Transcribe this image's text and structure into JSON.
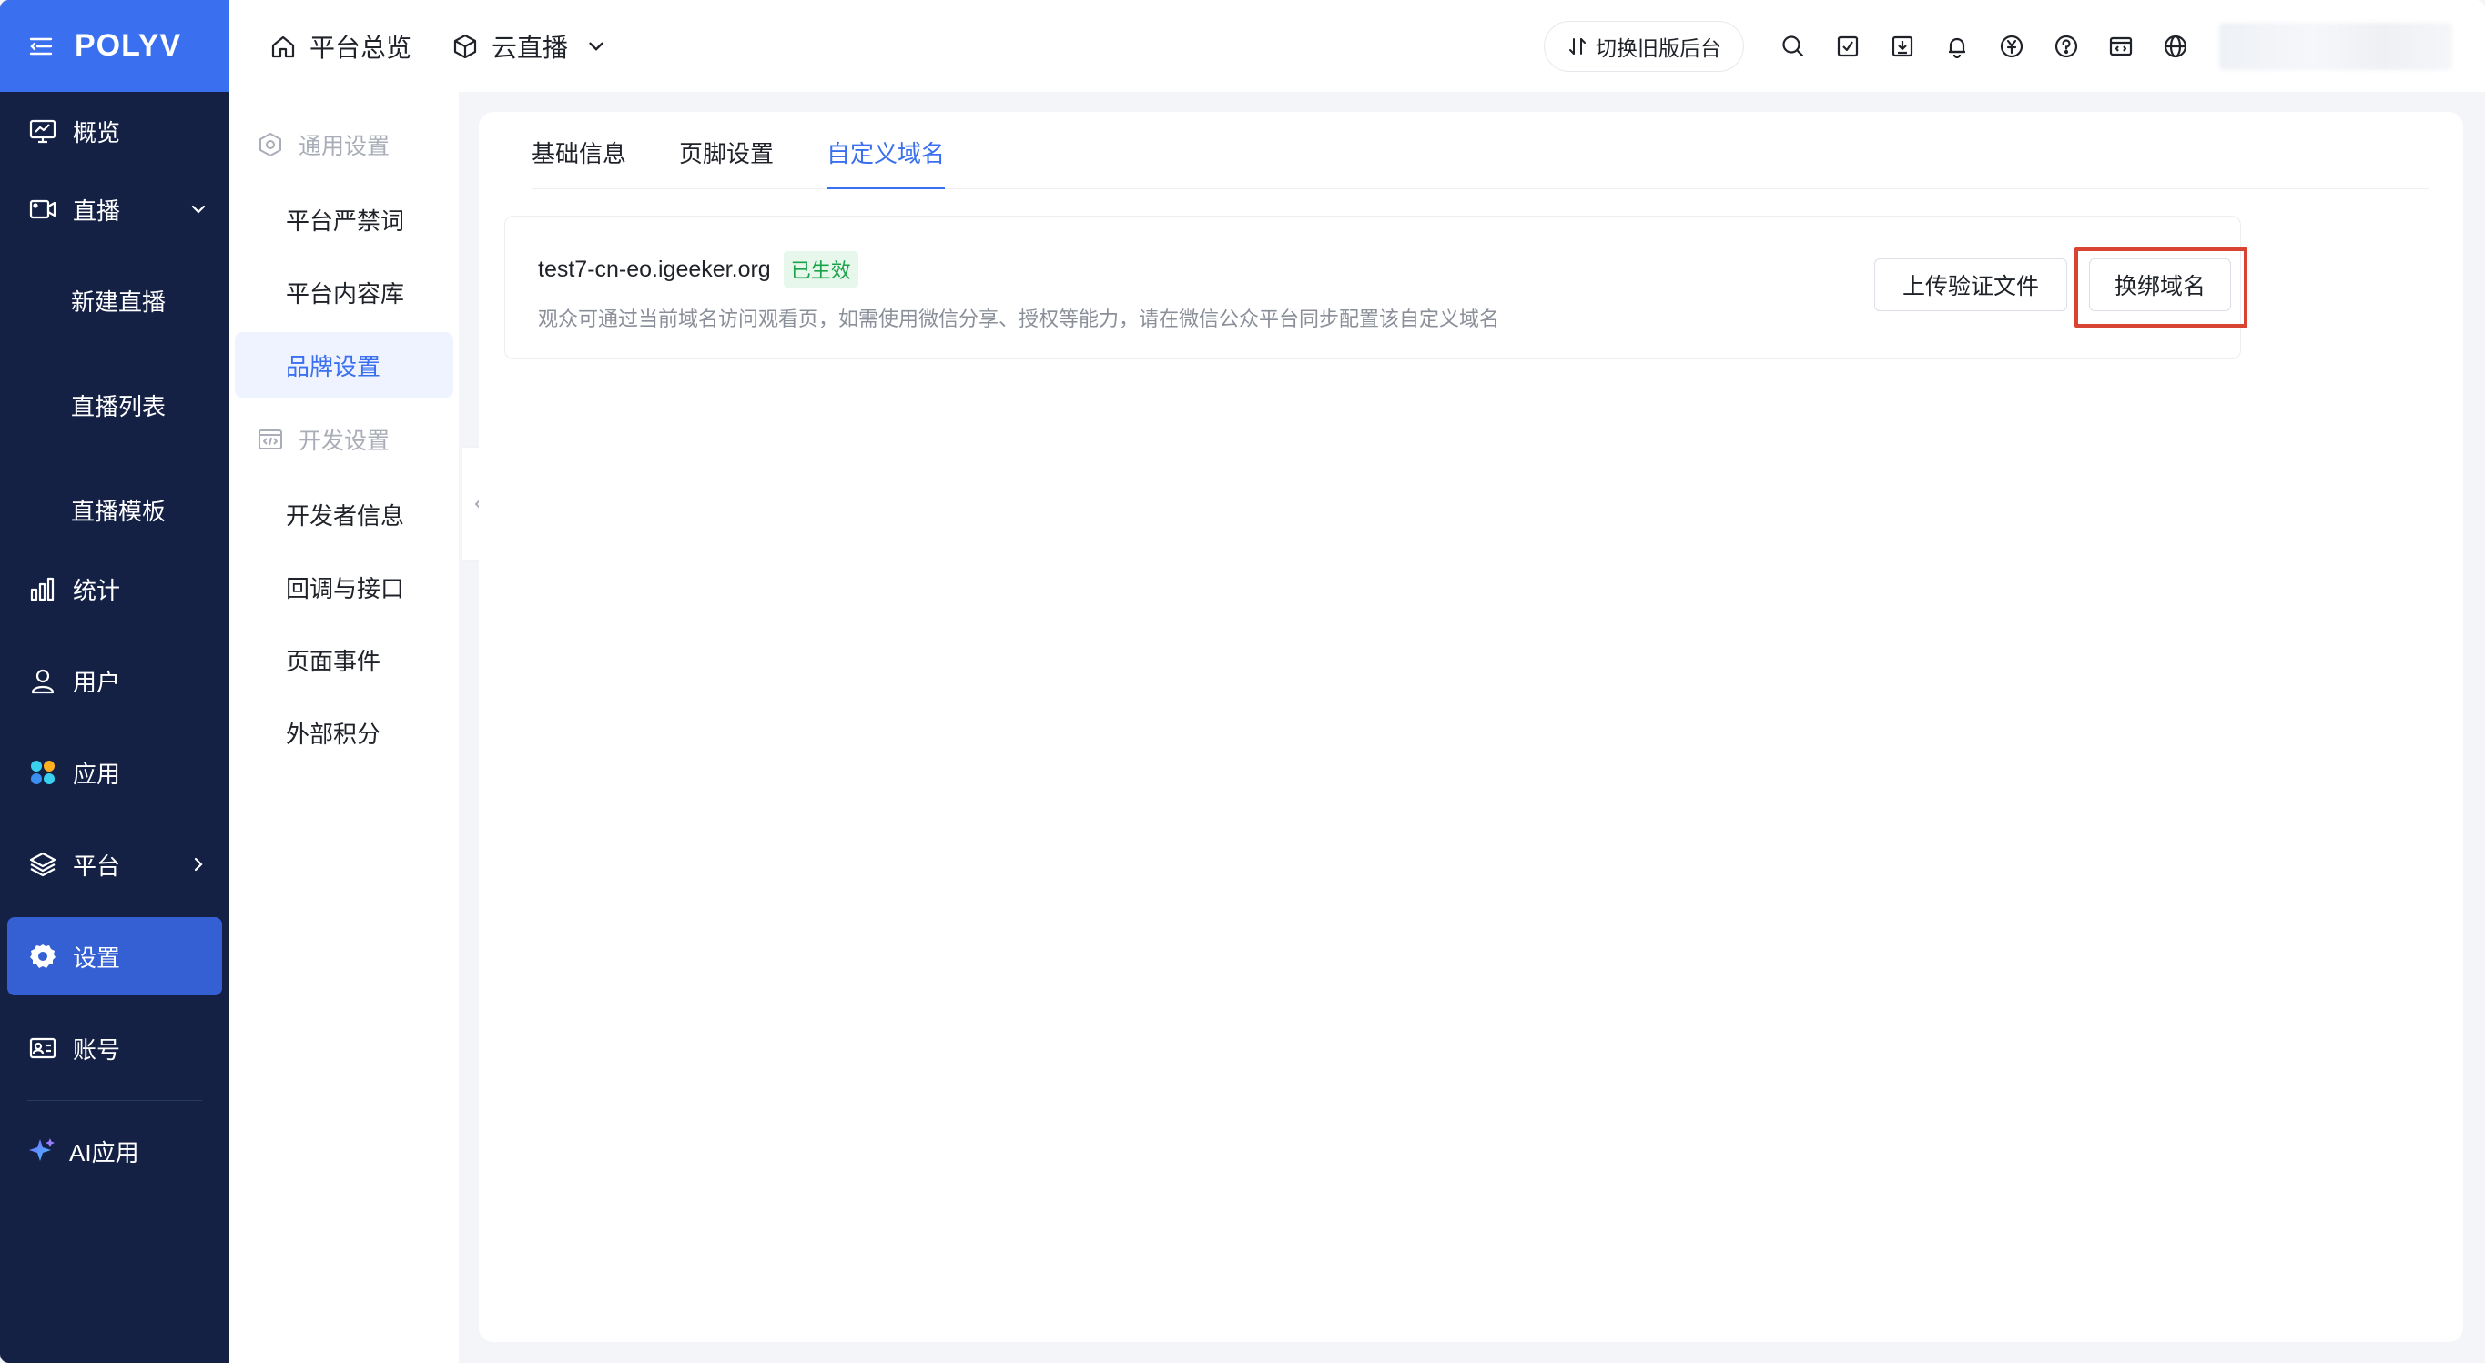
{
  "brand": {
    "logo_text": "POLYV",
    "accent": "#3a6ff0",
    "sidebar_bg": "#142145"
  },
  "header": {
    "home_label": "平台总览",
    "product_label": "云直播",
    "switch_label": "切换旧版后台",
    "icons": [
      "search-icon",
      "task-icon",
      "download-icon",
      "bell-icon",
      "billing-icon",
      "help-icon",
      "code-icon",
      "globe-icon"
    ]
  },
  "sidebar": {
    "items": [
      {
        "label": "概览",
        "icon": "monitor-icon"
      },
      {
        "label": "直播",
        "icon": "video-icon",
        "expanded": true,
        "children": [
          "新建直播",
          "直播列表",
          "直播模板"
        ]
      },
      {
        "label": "统计",
        "icon": "chart-icon"
      },
      {
        "label": "用户",
        "icon": "user-icon"
      },
      {
        "label": "应用",
        "icon": "apps-icon"
      },
      {
        "label": "平台",
        "icon": "layers-icon"
      },
      {
        "label": "设置",
        "icon": "gear-icon",
        "active": true
      },
      {
        "label": "账号",
        "icon": "id-card-icon"
      }
    ],
    "ai_label": "AI应用"
  },
  "submenu": {
    "group1": "通用设置",
    "group1_items": [
      "平台严禁词",
      "平台内容库",
      "品牌设置"
    ],
    "group2": "开发设置",
    "group2_items": [
      "开发者信息",
      "回调与接口",
      "页面事件",
      "外部积分"
    ],
    "active": "品牌设置"
  },
  "tabs": [
    "基础信息",
    "页脚设置",
    "自定义域名"
  ],
  "active_tab": "自定义域名",
  "domain": {
    "name": "test7-cn-eo.igeeker.org",
    "status": "已生效",
    "description": "观众可通过当前域名访问观看页，如需使用微信分享、授权等能力，请在微信公众平台同步配置该自定义域名",
    "upload_label": "上传验证文件",
    "rebind_label": "换绑域名"
  }
}
